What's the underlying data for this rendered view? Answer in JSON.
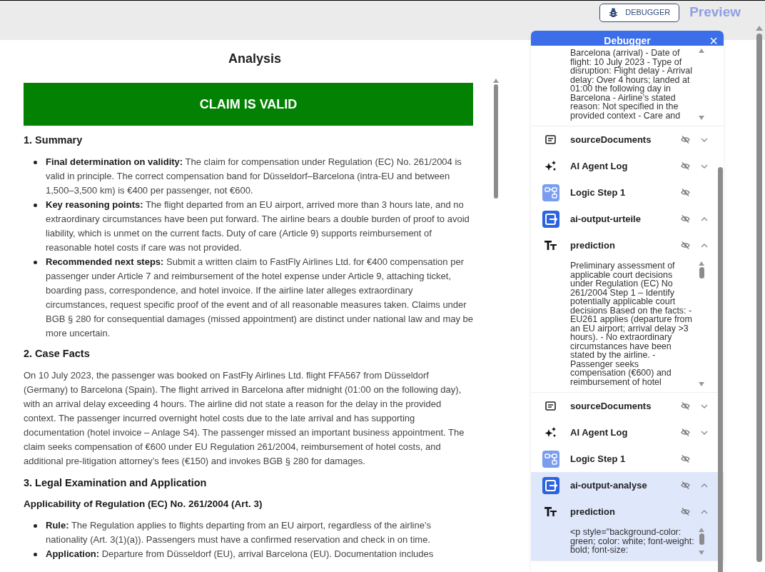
{
  "toolbar": {
    "debugger_button": "DEBUGGER",
    "preview_label": "Preview"
  },
  "analysis": {
    "title": "Analysis",
    "banner": "CLAIM IS VALID",
    "blocks": [
      {
        "kind": "h2",
        "text": "1. Summary"
      },
      {
        "kind": "bullets",
        "items": [
          "**Final determination on validity:** The claim for compensation under Regulation (EC) No. 261/2004 is valid in principle. The correct compensation band for Düsseldorf–Barcelona (intra-EU and between 1,500–3,500 km) is €400 per passenger, not €600.",
          "**Key reasoning points:** The flight departed from an EU airport, arrived more than 3 hours late, and no extraordinary circumstances have been put forward. The airline bears a double burden of proof to avoid liability, which is unmet on the current facts. Duty of care (Article 9) supports reimbursement of reasonable hotel costs if care was not provided.",
          "**Recommended next steps:** Submit a written claim to FastFly Airlines Ltd. for €400 compensation per passenger under Article 7 and reimbursement of the hotel expense under Article 9, attaching ticket, boarding pass, correspondence, and hotel invoice. If the airline later alleges extraordinary circumstances, request specific proof of the event and of all reasonable measures taken. Claims under BGB § 280 for consequential damages (missed appointment) are distinct under national law and may be more uncertain."
        ]
      },
      {
        "kind": "h2",
        "text": "2. Case Facts"
      },
      {
        "kind": "p",
        "text": "On 10 July 2023, the passenger was booked on FastFly Airlines Ltd. flight FFA567 from Düsseldorf (Germany) to Barcelona (Spain). The flight arrived in Barcelona after midnight (01:00 on the following day), with an arrival delay exceeding 4 hours. The airline did not state a reason for the delay in the provided context. The passenger incurred overnight hotel costs due to the late arrival and has supporting documentation (hotel invoice – Anlage S4). The passenger missed an important business appointment. The claim seeks compensation of €600 under EU Regulation 261/2004, reimbursement of hotel costs, and additional pre-litigation attorney’s fees (€150) and invokes BGB § 280 for damages."
      },
      {
        "kind": "h2",
        "text": "3. Legal Examination and Application"
      },
      {
        "kind": "h3",
        "text": "Applicability of Regulation (EC) No. 261/2004 (Art. 3)"
      },
      {
        "kind": "bullets",
        "items": [
          "**Rule:** The Regulation applies to flights departing from an EU airport, regardless of the airline’s nationality (Art. 3(1)(a)). Passengers must have a confirmed reservation and check in on time.",
          "**Application:** Departure from Düsseldorf (EU), arrival Barcelona (EU). Documentation includes"
        ]
      }
    ]
  },
  "debugger": {
    "title": "Debugger",
    "close": "×",
    "entries": [
      {
        "kind": "text",
        "highlighted": false,
        "thumb": false,
        "text": "Barcelona (arrival) - Date of flight: 10 July 2023 - Type of disruption: Flight delay - Arrival delay: Over 4 hours; landed at 01:00 the following day in Barcelona - Airline’s stated reason: Not specified in the provided context - Care and"
      },
      {
        "kind": "documents",
        "label": "sourceDocuments",
        "expanded": false,
        "highlighted": false
      },
      {
        "kind": "agent",
        "label": "AI Agent Log",
        "expanded": false,
        "highlighted": false
      },
      {
        "kind": "logic",
        "label": "Logic Step 1",
        "highlighted": false
      },
      {
        "kind": "output",
        "label": "ai-output-urteile",
        "expanded": true,
        "highlighted": false
      },
      {
        "kind": "field",
        "label": "prediction",
        "expanded": true,
        "highlighted": false
      },
      {
        "kind": "text",
        "highlighted": false,
        "thumb": true,
        "text": "Preliminary assessment of applicable court decisions under Regulation (EC) No 261/2004 Step 1 – Identify potentially applicable court decisions Based on the facts: - EU261 applies (departure from an EU airport; arrival delay >3 hours). - No extraordinary circumstances have been stated by the airline. - Passenger seeks compensation (€600) and reimbursement of hotel"
      },
      {
        "kind": "documents",
        "label": "sourceDocuments",
        "expanded": false,
        "highlighted": false
      },
      {
        "kind": "agent",
        "label": "AI Agent Log",
        "expanded": false,
        "highlighted": false
      },
      {
        "kind": "logic",
        "label": "Logic Step 1",
        "highlighted": false
      },
      {
        "kind": "output",
        "label": "ai-output-analyse",
        "expanded": true,
        "highlighted": true
      },
      {
        "kind": "field",
        "label": "prediction",
        "expanded": true,
        "highlighted": true
      },
      {
        "kind": "text",
        "highlighted": true,
        "thumb": true,
        "text": "<p style=\"background-color: green; color: white; font-weight: bold; font-size:"
      }
    ]
  }
}
